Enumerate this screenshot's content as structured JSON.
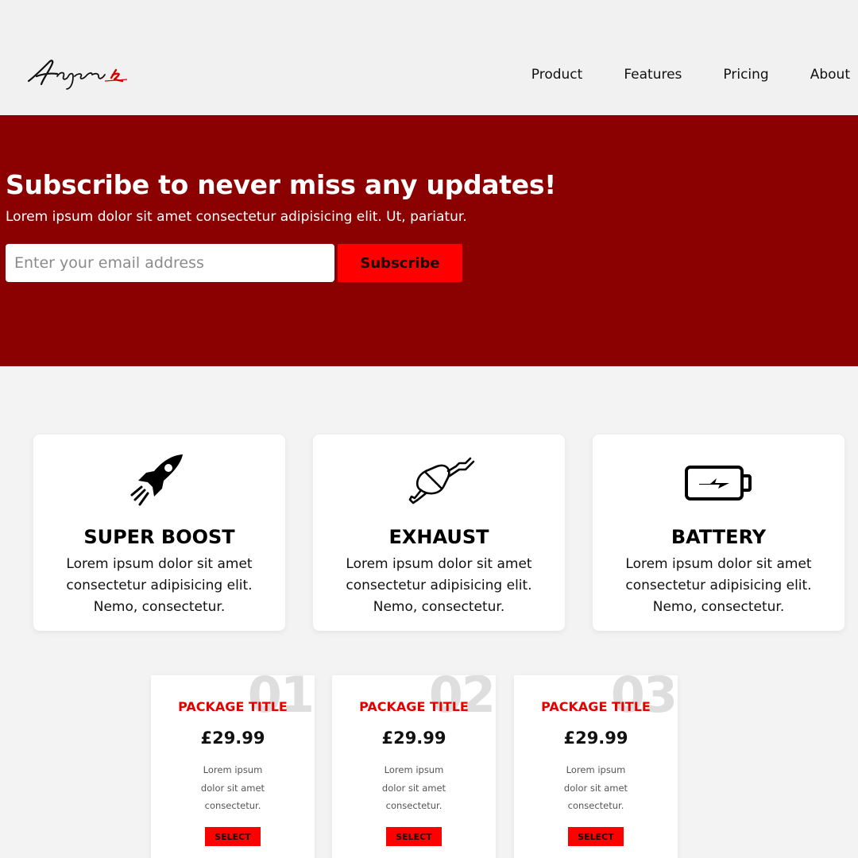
{
  "header": {
    "logo_text": "Agera R",
    "nav": [
      "Product",
      "Features",
      "Pricing",
      "About"
    ]
  },
  "hero": {
    "title": "Subscribe to never miss any updates!",
    "subtitle": "Lorem ipsum dolor sit amet consectetur adipisicing elit. Ut, pariatur.",
    "email_placeholder": "Enter your email address",
    "subscribe_label": "Subscribe"
  },
  "features": [
    {
      "icon": "rocket-icon",
      "title": "SUPER BOOST",
      "text": "Lorem ipsum dolor sit amet consectetur adipisicing elit. Nemo, consectetur."
    },
    {
      "icon": "exhaust-icon",
      "title": "EXHAUST",
      "text": "Lorem ipsum dolor sit amet consectetur adipisicing elit. Nemo, consectetur."
    },
    {
      "icon": "battery-icon",
      "title": "BATTERY",
      "text": "Lorem ipsum dolor sit amet consectetur adipisicing elit. Nemo, consectetur."
    }
  ],
  "pricing": [
    {
      "number": "01",
      "title": "PACKAGE TITLE",
      "price": "£29.99",
      "text": "Lorem ipsum dolor sit amet consectetur.",
      "button": "SELECT"
    },
    {
      "number": "02",
      "title": "PACKAGE TITLE",
      "price": "£29.99",
      "text": "Lorem ipsum dolor sit amet consectetur.",
      "button": "SELECT"
    },
    {
      "number": "03",
      "title": "PACKAGE TITLE",
      "price": "£29.99",
      "text": "Lorem ipsum dolor sit amet consectetur.",
      "button": "SELECT"
    }
  ],
  "colors": {
    "hero_bg": "#8b0000",
    "accent": "#ff0000",
    "package_title": "#e50000",
    "page_bg": "#f3f3f3"
  }
}
